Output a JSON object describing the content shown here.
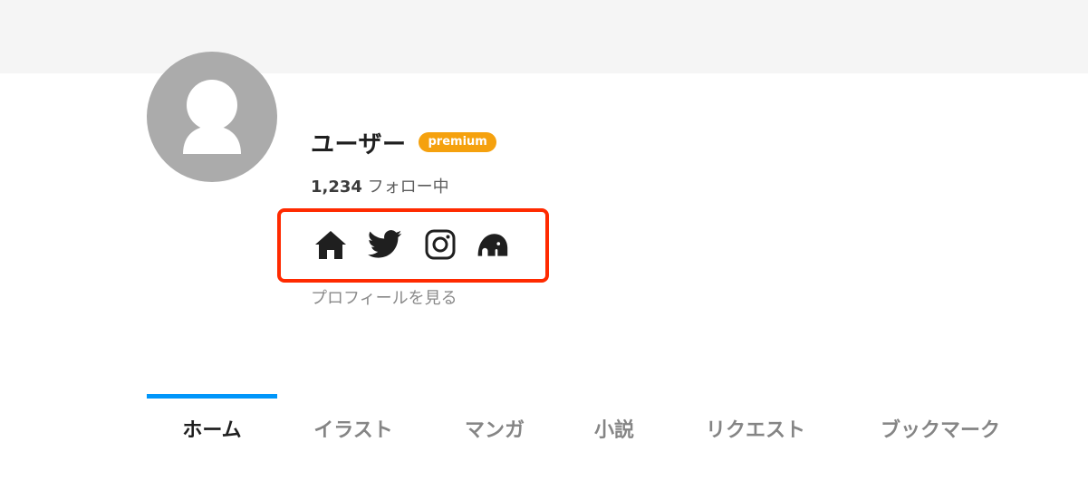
{
  "profile": {
    "username": "ユーザー",
    "badge": "premium",
    "following_count": "1,234",
    "following_label": "フォロー中",
    "view_profile_label": "プロフィールを見る"
  },
  "social_links": [
    {
      "icon": "home-icon"
    },
    {
      "icon": "twitter-icon"
    },
    {
      "icon": "instagram-icon"
    },
    {
      "icon": "pawoo-icon"
    }
  ],
  "tabs": [
    {
      "label": "ホーム",
      "active": true
    },
    {
      "label": "イラスト"
    },
    {
      "label": "マンガ"
    },
    {
      "label": "小説"
    },
    {
      "label": "リクエスト"
    },
    {
      "label": "ブックマーク"
    }
  ],
  "colors": {
    "accent": "#0096fa",
    "premium_badge": "#f5a10e",
    "highlight_box": "#ff2a00",
    "cover": "#f5f5f5",
    "avatar_bg": "#ababab"
  }
}
